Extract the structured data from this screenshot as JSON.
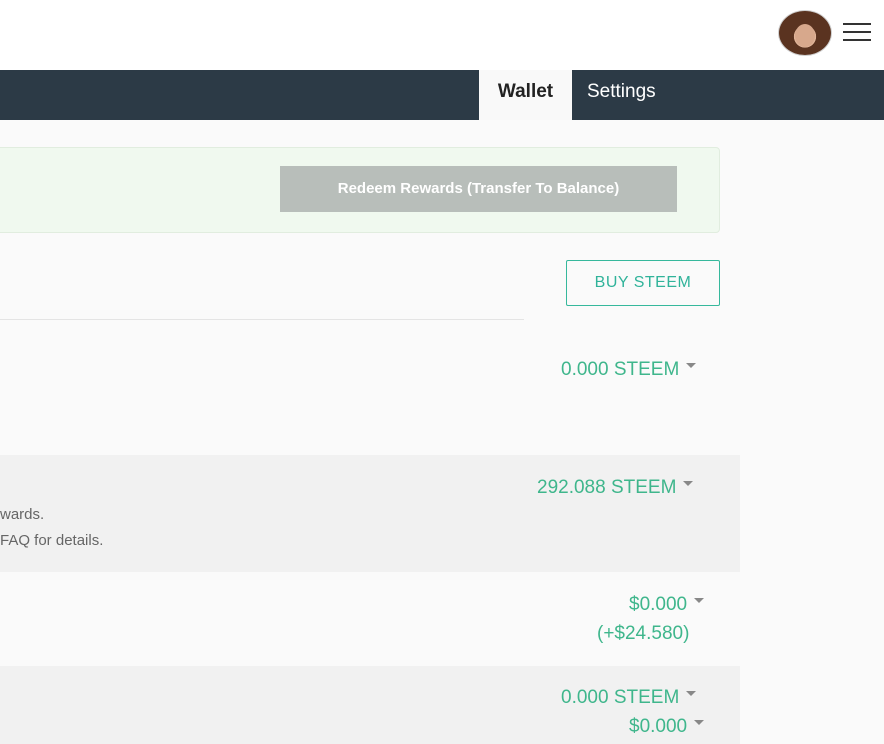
{
  "navbar": {
    "tabs": [
      {
        "label": "Wallet",
        "active": true
      },
      {
        "label": "Settings",
        "active": false
      }
    ]
  },
  "rewards": {
    "redeem_label": "Redeem Rewards (Transfer To Balance)"
  },
  "buy_label": "BUY STEEM",
  "balances": [
    {
      "amount": "0.000 STEEM",
      "sub": "",
      "description": []
    },
    {
      "amount": "292.088 STEEM",
      "sub": "",
      "description": [
        "wards.",
        "FAQ for details."
      ]
    },
    {
      "amount": "$0.000",
      "sub": "(+$24.580)",
      "description": []
    },
    {
      "amount": "0.000 STEEM",
      "sub": "$0.000",
      "description": []
    }
  ],
  "colors": {
    "accent": "#3fb68c",
    "navbar": "#2c3a46",
    "rewards_bg": "#f0f9ef",
    "button_disabled": "#b8beba"
  },
  "icons": {
    "avatar": "avatar",
    "menu": "hamburger-menu-icon",
    "dropdown": "caret-down-icon"
  }
}
